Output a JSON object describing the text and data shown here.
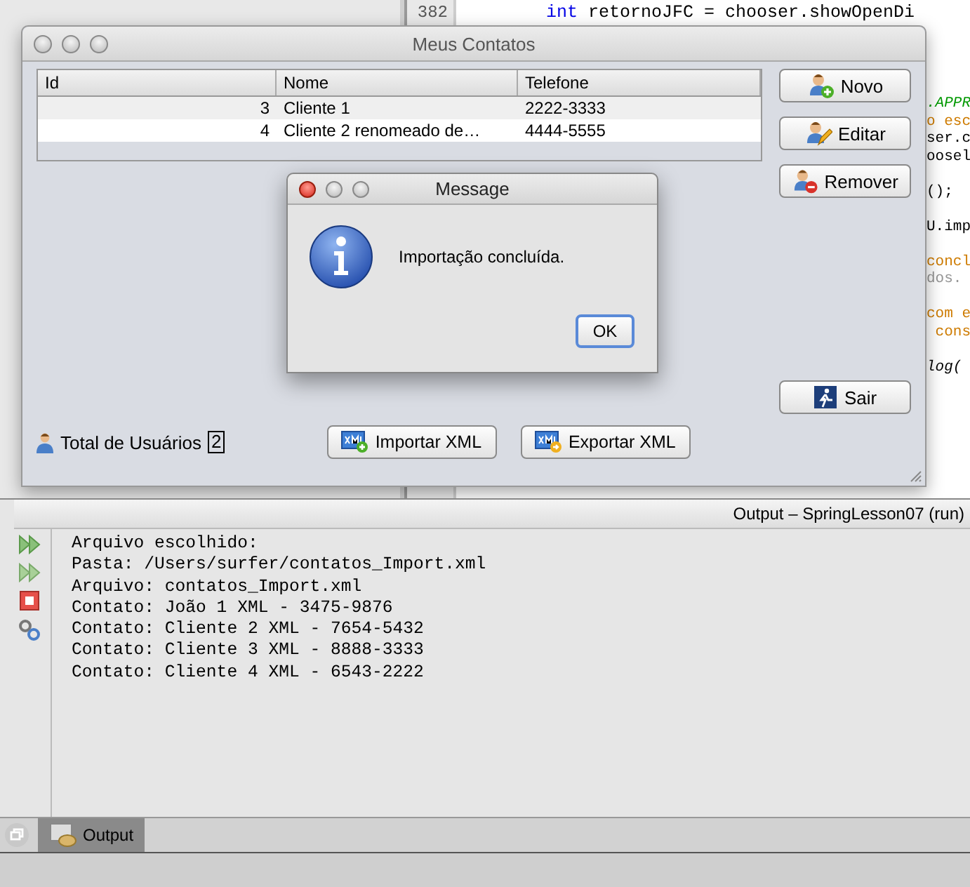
{
  "ide": {
    "line_numbers": [
      "382"
    ],
    "code_lines": [
      [
        {
          "text": "int",
          "kind": "keyword"
        },
        {
          "text": " retornoJFC = chooser.showOpenDi",
          "kind": "plain"
        }
      ]
    ],
    "code_fragments": [
      {
        "text": ".APPR",
        "kind": "constant"
      },
      {
        "text": "o esc",
        "kind": "string"
      },
      {
        "text": "ser.c",
        "kind": "plain"
      },
      {
        "text": "oosel",
        "kind": "plain"
      },
      {
        "kind": "blank"
      },
      {
        "text": "();",
        "kind": "plain"
      },
      {
        "kind": "blank"
      },
      {
        "text": "U.imp",
        "kind": "plain"
      },
      {
        "kind": "blank"
      },
      {
        "text": "concl",
        "kind": "string"
      },
      {
        "text": "dos.",
        "kind": "comment"
      },
      {
        "kind": "blank"
      },
      {
        "text": "com e",
        "kind": "string"
      },
      {
        "text": " cons",
        "kind": "string"
      },
      {
        "kind": "blank"
      },
      {
        "text": "log(",
        "kind": "method"
      }
    ]
  },
  "window": {
    "title": "Meus Contatos",
    "active": false,
    "table": {
      "columns": [
        "Id",
        "Nome",
        "Telefone"
      ],
      "rows": [
        [
          "3",
          "Cliente 1",
          "2222-3333"
        ],
        [
          "4",
          "Cliente 2 renomeado de…",
          "4444-5555"
        ]
      ]
    },
    "side_buttons": [
      {
        "label": "Novo",
        "kind": "add"
      },
      {
        "label": "Editar",
        "kind": "edit"
      },
      {
        "label": "Remover",
        "kind": "remove"
      }
    ],
    "exit_button": "Sair",
    "total_label": "Total de Usuários",
    "total_value": "2",
    "bottom_buttons": [
      {
        "label": "Importar XML",
        "kind": "import"
      },
      {
        "label": "Exportar XML",
        "kind": "export"
      }
    ]
  },
  "dialog": {
    "title": "Message",
    "active": true,
    "message": "Importação concluída.",
    "button": "OK"
  },
  "output": {
    "title": "Output – SpringLesson07 (run)",
    "lines": [
      "Arquivo escolhido:",
      "Pasta: /Users/surfer/contatos_Import.xml",
      "Arquivo: contatos_Import.xml",
      "Contato: João 1 XML - 3475-9876",
      "Contato: Cliente 2 XML - 7654-5432",
      "Contato: Cliente 3 XML - 8888-3333",
      "Contato: Cliente 4 XML - 6543-2222"
    ]
  },
  "bottom_tabs": [
    {
      "label": "Output",
      "selected": true
    }
  ]
}
